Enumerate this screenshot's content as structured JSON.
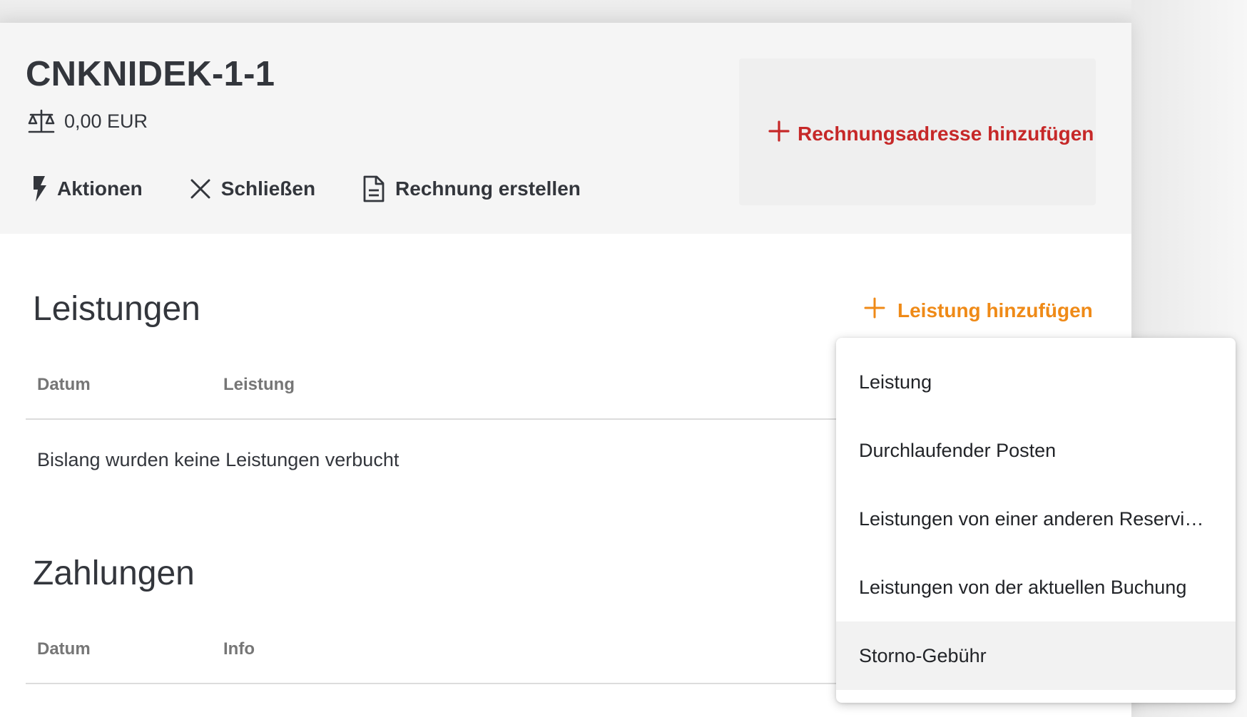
{
  "folio": {
    "title": "CNKNIDEK-1-1",
    "balance": "0,00 EUR"
  },
  "actions": {
    "aktionen": "Aktionen",
    "schliessen": "Schließen",
    "rechnung": "Rechnung erstellen"
  },
  "billing_address": {
    "add_label": "Rechnungsadresse hinzufügen"
  },
  "services": {
    "title": "Leistungen",
    "add_label": "Leistung hinzufügen",
    "columns": [
      "Datum",
      "Leistung"
    ],
    "empty_text": "Bislang wurden keine Leistungen verbucht"
  },
  "payments": {
    "title": "Zahlungen",
    "columns": [
      "Datum",
      "Info"
    ]
  },
  "add_menu": {
    "items": [
      "Leistung",
      "Durchlaufender Posten",
      "Leistungen von einer anderen Reservierung",
      "Leistungen von der aktuellen Buchung",
      "Storno-Gebühr"
    ],
    "highlighted_index": 4
  },
  "icons": {
    "balance": "balance-scale-icon",
    "actions": "lightning-bolt-icon",
    "close": "close-x-icon",
    "invoice": "document-icon",
    "add": "plus-icon"
  },
  "colors": {
    "header_bg": "#f5f5f5",
    "address_accent": "#c62828",
    "add_accent": "#ef8a17",
    "text": "#33363c",
    "muted": "#767676",
    "menu_hover": "#f2f2f2"
  }
}
